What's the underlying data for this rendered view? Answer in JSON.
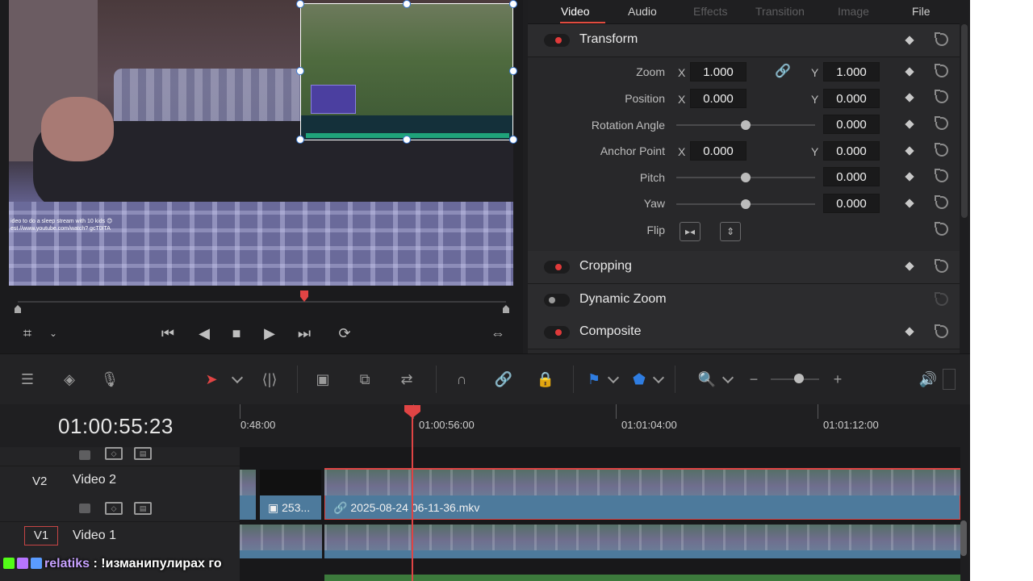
{
  "inspector": {
    "tabs": [
      {
        "label": "Video",
        "state": "active"
      },
      {
        "label": "Audio",
        "state": "enabled"
      },
      {
        "label": "Effects",
        "state": "disabled"
      },
      {
        "label": "Transition",
        "state": "disabled"
      },
      {
        "label": "Image",
        "state": "disabled"
      },
      {
        "label": "File",
        "state": "enabled"
      }
    ],
    "transform": {
      "title": "Transform",
      "zoom": {
        "label": "Zoom",
        "x_axis": "X",
        "x": "1.000",
        "y_axis": "Y",
        "y": "1.000"
      },
      "position": {
        "label": "Position",
        "x_axis": "X",
        "x": "0.000",
        "y_axis": "Y",
        "y": "0.000"
      },
      "rotation": {
        "label": "Rotation Angle",
        "value": "0.000"
      },
      "anchor": {
        "label": "Anchor Point",
        "x_axis": "X",
        "x": "0.000",
        "y_axis": "Y",
        "y": "0.000"
      },
      "pitch": {
        "label": "Pitch",
        "value": "0.000"
      },
      "yaw": {
        "label": "Yaw",
        "value": "0.000"
      },
      "flip": {
        "label": "Flip"
      }
    },
    "sections": [
      {
        "title": "Cropping",
        "enabled": true
      },
      {
        "title": "Dynamic Zoom",
        "enabled": false
      },
      {
        "title": "Composite",
        "enabled": true
      }
    ]
  },
  "viewer": {
    "overlay_text": "ideo to do a sleep stream with 10 kids 😊 est //www.youtube.com/watch? gcT0ITA"
  },
  "timeline": {
    "timecode": "01:00:55:23",
    "ruler_labels": [
      "0:48:00",
      "01:00:56:00",
      "01:01:04:00",
      "01:01:12:00"
    ],
    "tracks": [
      {
        "code": "V2",
        "name": "Video 2"
      },
      {
        "code": "V1",
        "name": "Video 1"
      }
    ],
    "clips": {
      "v2_short": "253...",
      "v2_main": "2025-08-24 06-11-36.mkv"
    }
  },
  "chat": {
    "user": "relatiks",
    "separator": ":",
    "message": "!изманипулирах го"
  },
  "colors": {
    "accent_red": "#e04444",
    "clip_blue": "#4d7a9c",
    "marker_blue": "#2f7de1"
  }
}
